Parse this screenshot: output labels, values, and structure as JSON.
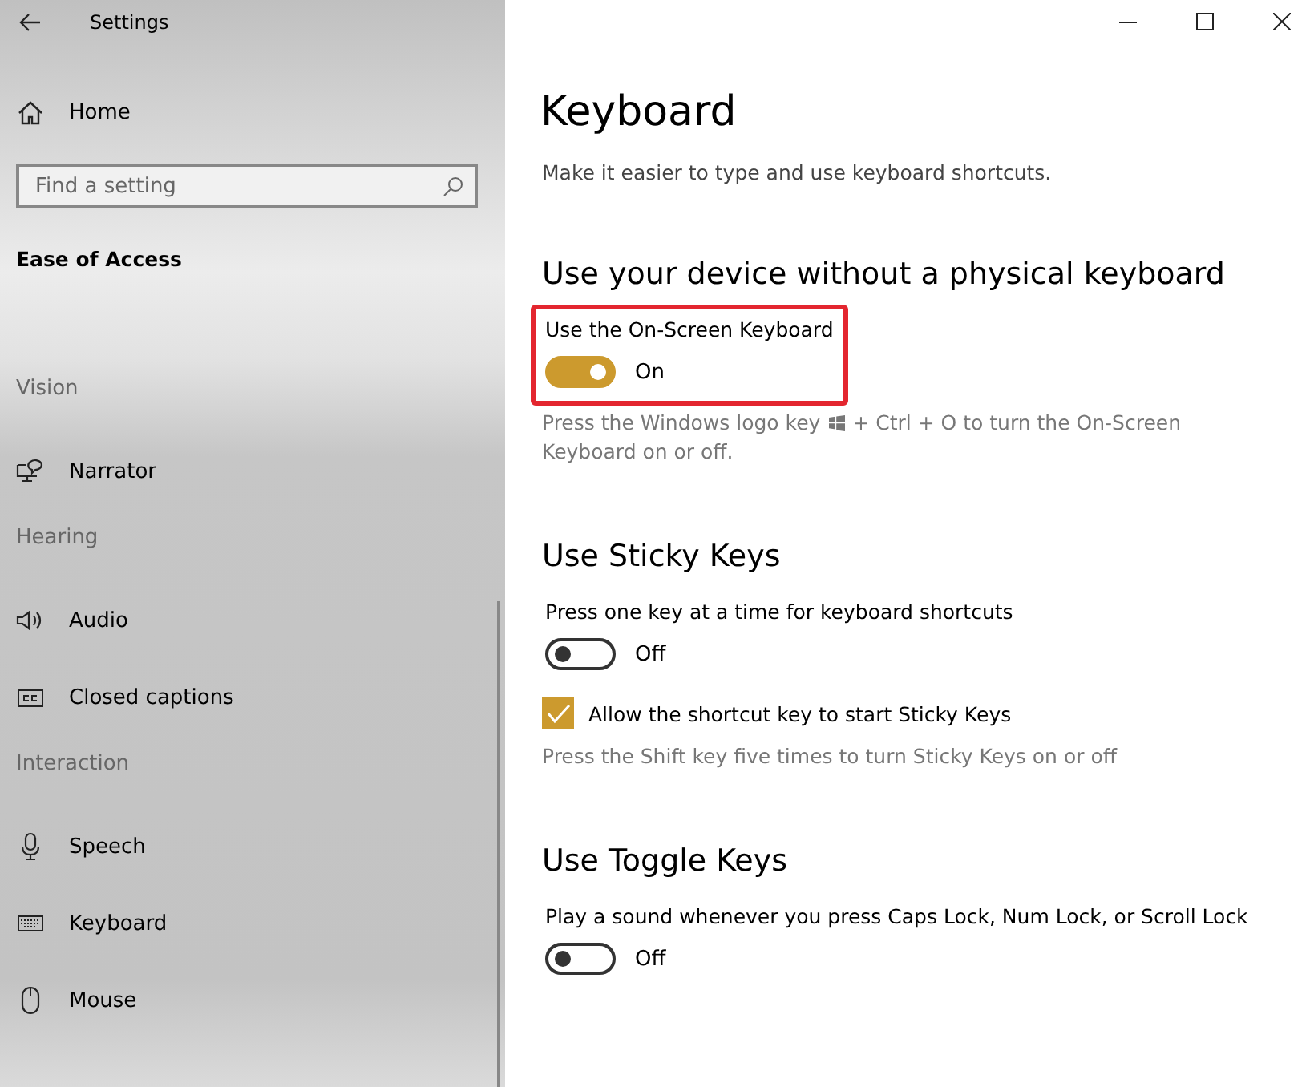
{
  "window": {
    "title": "Settings"
  },
  "sidebar": {
    "home": "Home",
    "search": {
      "placeholder": "Find a setting"
    },
    "category": "Ease of Access",
    "sections": [
      {
        "heading": "Vision",
        "items": [
          {
            "label": "Narrator"
          }
        ]
      },
      {
        "heading": "Hearing",
        "items": [
          {
            "label": "Audio"
          },
          {
            "label": "Closed captions"
          }
        ]
      },
      {
        "heading": "Interaction",
        "items": [
          {
            "label": "Speech"
          },
          {
            "label": "Keyboard"
          },
          {
            "label": "Mouse"
          }
        ]
      }
    ]
  },
  "page": {
    "title": "Keyboard",
    "description": "Make it easier to type and use keyboard shortcuts.",
    "groups": [
      {
        "heading": "Use your device without a physical keyboard",
        "settings": [
          {
            "kind": "toggle",
            "label": "Use the On-Screen Keyboard",
            "on": true,
            "state_text": "On",
            "highlighted": true
          },
          {
            "kind": "hint",
            "text_before_icon": "Press the Windows logo key",
            "text_after_icon": "+ Ctrl + O to turn the On-Screen",
            "text_second_line": "Keyboard on or off."
          }
        ]
      },
      {
        "heading": "Use Sticky Keys",
        "settings": [
          {
            "kind": "toggle",
            "label": "Press one key at a time for keyboard shortcuts",
            "on": false,
            "state_text": "Off",
            "highlighted": false
          },
          {
            "kind": "checkbox",
            "label": "Allow the shortcut key to start Sticky Keys",
            "checked": true
          },
          {
            "kind": "hint",
            "text": "Press the Shift key five times to turn Sticky Keys on or off"
          }
        ]
      },
      {
        "heading": "Use Toggle Keys",
        "settings": [
          {
            "kind": "toggle",
            "label": "Play a sound whenever you press Caps Lock, Num Lock, or Scroll Lock",
            "on": false,
            "state_text": "Off",
            "highlighted": false
          }
        ]
      }
    ]
  }
}
